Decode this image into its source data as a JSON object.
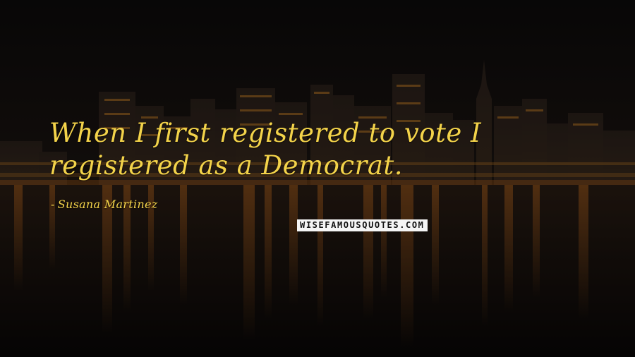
{
  "quote": {
    "text": "When I first registered to vote I registered as a Democrat."
  },
  "author": {
    "dash": "-",
    "name": "Susana Martinez"
  },
  "watermark": {
    "text": "WISEFAMOUSQUOTES.COM"
  },
  "colors": {
    "text": "#f3d34a",
    "background": "#0c0a0a",
    "skyline_light": "#d98a2a",
    "water_reflection": "#b5651d"
  },
  "scene": "night-city-skyline-over-water"
}
